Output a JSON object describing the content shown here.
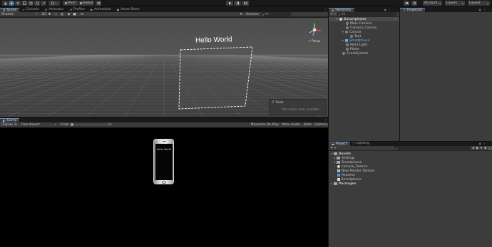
{
  "toolbar": {
    "pivot": "Pivot",
    "global": "Global",
    "account": "Account",
    "layers": "Layers",
    "layout": "Layout"
  },
  "scene_tabs": [
    "Scene",
    "Console",
    "Animator",
    "Profiler",
    "Animation",
    "Asset Store"
  ],
  "scene": {
    "shading": "Shaded",
    "mode2d": "2D",
    "gizmos": "Gizmos",
    "search_prefix": "All",
    "persp": "< Persp",
    "hello_text": "Hello World",
    "tools_title": "Tools",
    "tools_msg": "No custom tools available"
  },
  "game": {
    "tab": "Game",
    "display": "Display 1",
    "aspect": "Free Aspect",
    "scale_label": "Scale",
    "scale_value": "1x",
    "maximize": "Maximize On Play",
    "mute": "Mute Audio",
    "stats": "Stats",
    "gizmos": "Gizmos",
    "phone_text": "Hello World"
  },
  "hierarchy": {
    "tab": "Hierarchy",
    "search_prefix": "All",
    "items": [
      {
        "label": "Smartphone",
        "bold": true
      },
      {
        "label": "Main Camera"
      },
      {
        "label": "Camera_Canvas"
      },
      {
        "label": "Canvas"
      },
      {
        "label": "Text"
      },
      {
        "label": "Smartphone",
        "selected": true
      },
      {
        "label": "Point Light"
      },
      {
        "label": "Plane"
      },
      {
        "label": "EventSystem"
      }
    ]
  },
  "inspector": {
    "tab": "Inspector"
  },
  "project": {
    "tabs": [
      "Project",
      "Lighting"
    ],
    "count": "12",
    "items": [
      {
        "label": "Assets",
        "bold": true
      },
      {
        "label": "Settings"
      },
      {
        "label": "Smartphone"
      },
      {
        "label": "camera_Texture"
      },
      {
        "label": "New Render Texture"
      },
      {
        "label": "Readme"
      },
      {
        "label": "Smartphone"
      },
      {
        "label": "Packages",
        "bold": true
      }
    ]
  },
  "colors": {
    "accent": "#4a90d9",
    "selection": "#2c5d87",
    "hello_scene": "#ffffff",
    "hello_phone": "#cfd8e0"
  }
}
